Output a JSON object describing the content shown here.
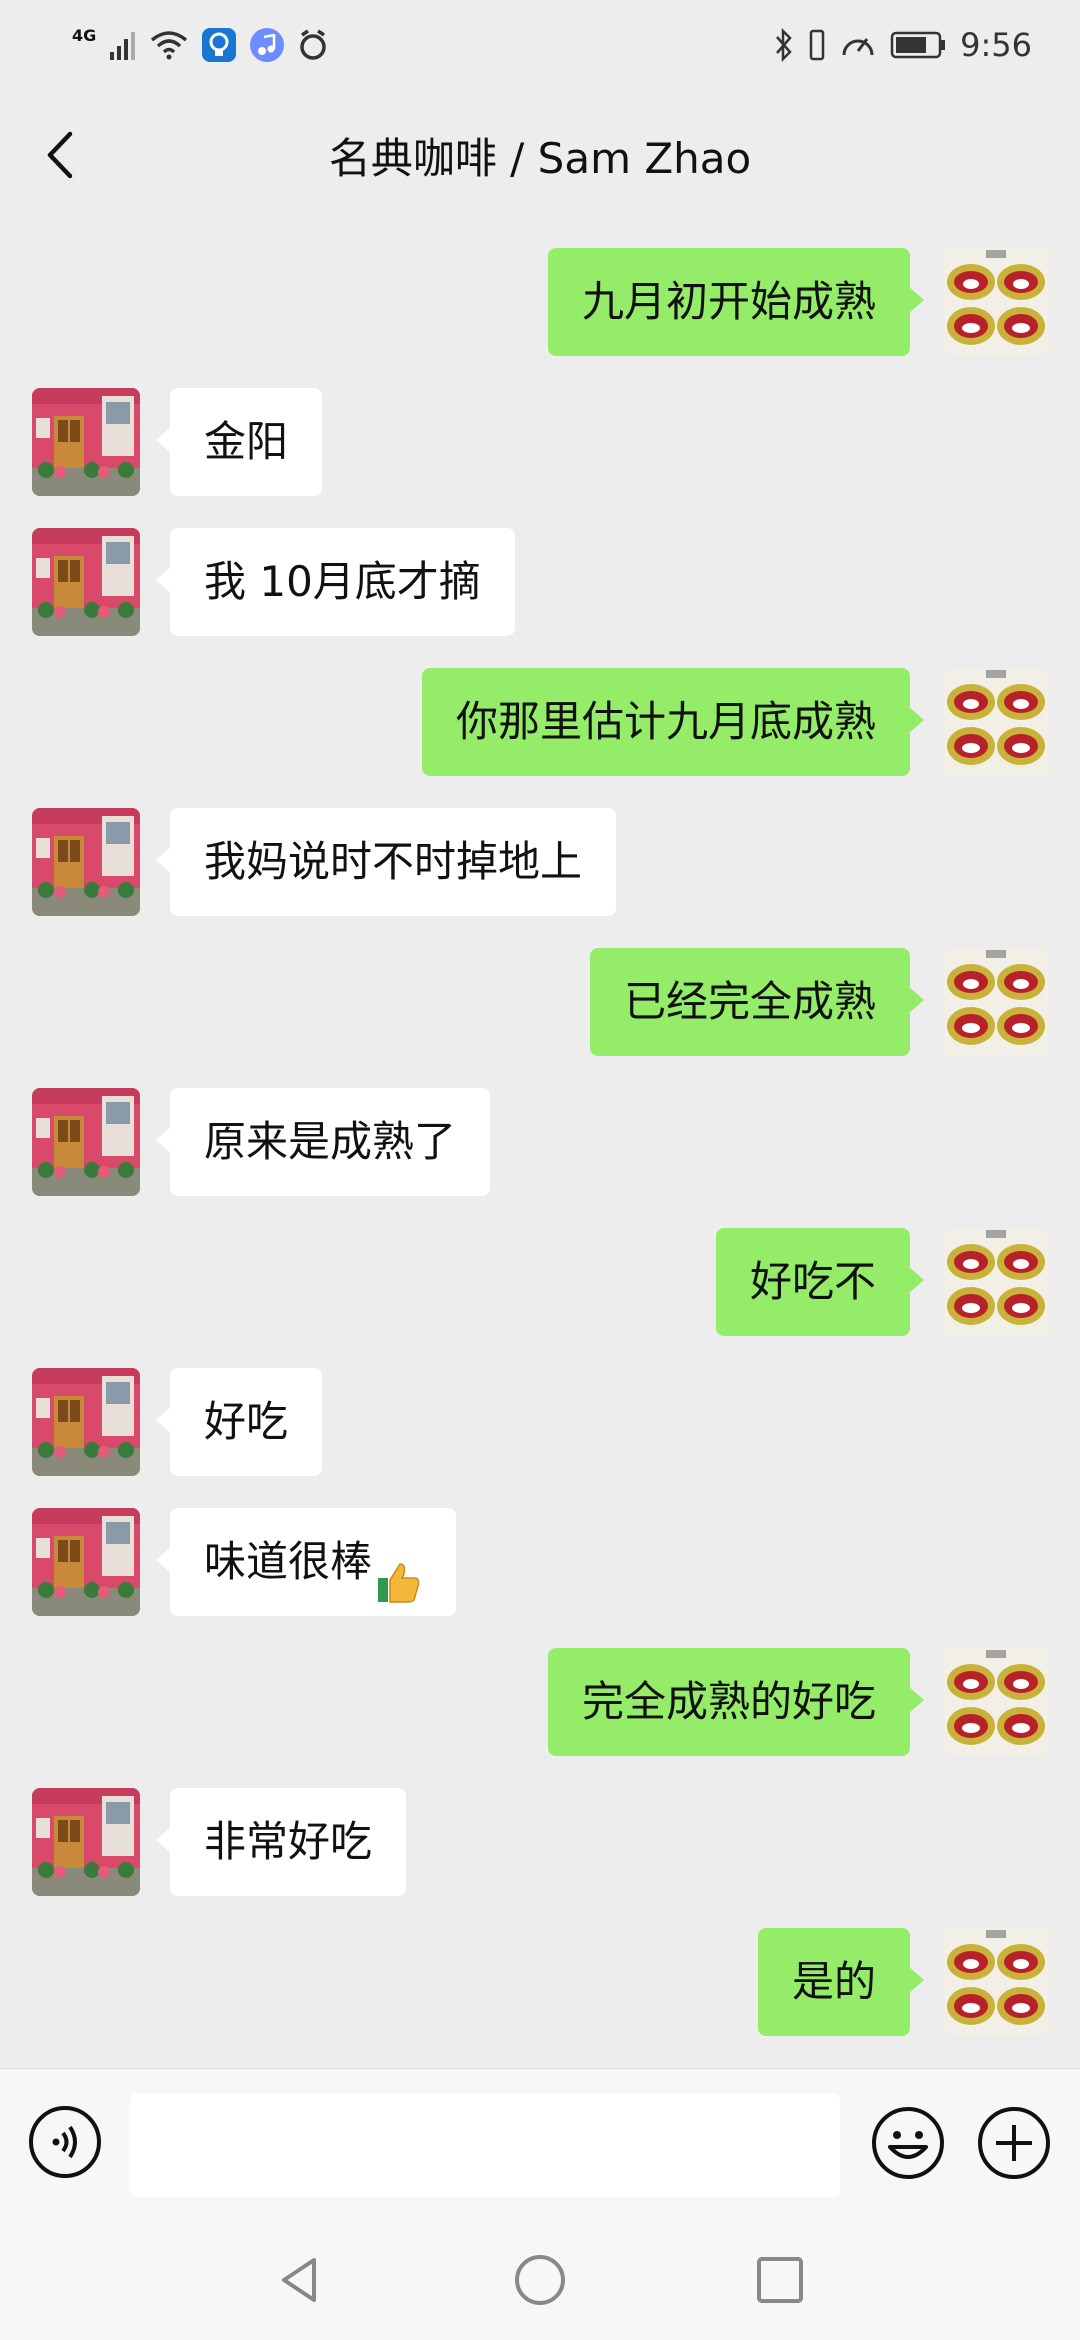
{
  "status_bar": {
    "network": "4G",
    "time": "9:56"
  },
  "header": {
    "title": "名典咖啡 / Sam Zhao"
  },
  "messages": [
    {
      "side": "right",
      "text": "九月初开始成熟"
    },
    {
      "side": "left",
      "text": "金阳"
    },
    {
      "side": "left",
      "text": "我 10月底才摘"
    },
    {
      "side": "right",
      "text": "你那里估计九月底成熟"
    },
    {
      "side": "left",
      "text": "我妈说时不时掉地上"
    },
    {
      "side": "right",
      "text": "已经完全成熟"
    },
    {
      "side": "left",
      "text": "原来是成熟了"
    },
    {
      "side": "right",
      "text": "好吃不"
    },
    {
      "side": "left",
      "text": "好吃"
    },
    {
      "side": "left",
      "text": "味道很棒",
      "emoji": "thumbs-up-icon"
    },
    {
      "side": "right",
      "text": "完全成熟的好吃"
    },
    {
      "side": "left",
      "text": "非常好吃"
    },
    {
      "side": "right",
      "text": "是的"
    }
  ],
  "input_bar": {
    "value": "",
    "placeholder": ""
  },
  "colors": {
    "background": "#ededed",
    "sent_bubble": "#95ec69",
    "received_bubble": "#ffffff"
  }
}
